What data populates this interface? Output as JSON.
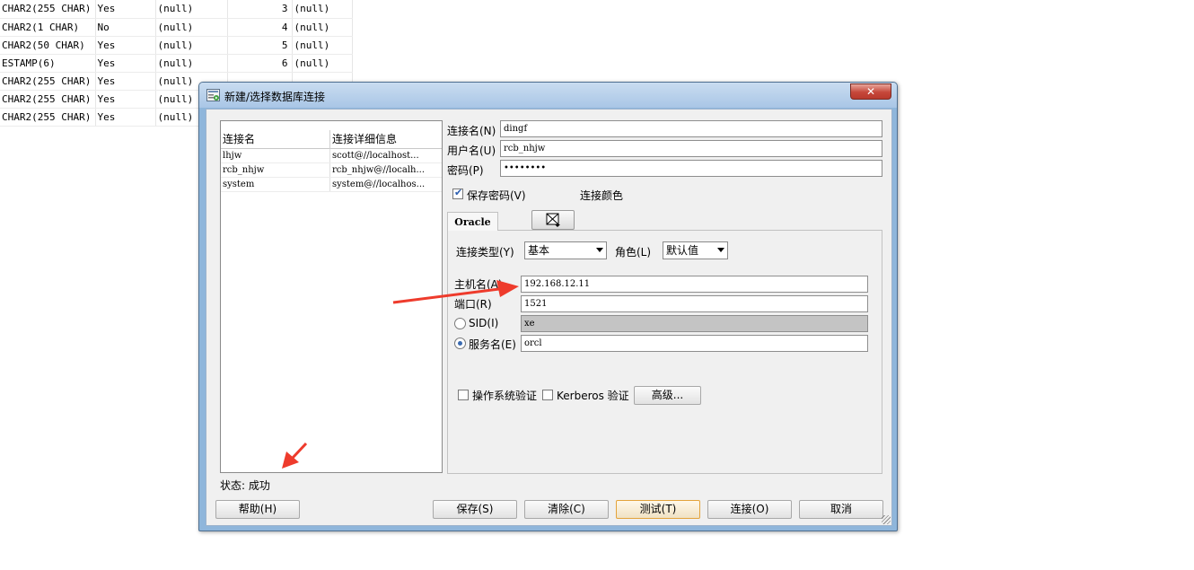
{
  "background_table": [
    [
      "CHAR2(255 CHAR)",
      "Yes",
      "(null)",
      "3",
      "(null)"
    ],
    [
      "CHAR2(1 CHAR)",
      "No",
      "(null)",
      "4",
      "(null)"
    ],
    [
      "CHAR2(50 CHAR)",
      "Yes",
      "(null)",
      "5",
      "(null)"
    ],
    [
      "ESTAMP(6)",
      "Yes",
      "(null)",
      "6",
      "(null)"
    ],
    [
      "CHAR2(255 CHAR)",
      "Yes",
      "(null)",
      "",
      ""
    ],
    [
      "CHAR2(255 CHAR)",
      "Yes",
      "(null)",
      "",
      ""
    ],
    [
      "CHAR2(255 CHAR)",
      "Yes",
      "(null)",
      "",
      ""
    ]
  ],
  "dialog": {
    "title": "新建/选择数据库连接",
    "close_label": "✕",
    "list": {
      "headers": [
        "连接名",
        "连接详细信息"
      ],
      "rows": [
        [
          "lhjw",
          "scott@//localhost..."
        ],
        [
          "rcb_nhjw",
          "rcb_nhjw@//localh..."
        ],
        [
          "system",
          "system@//localhos..."
        ]
      ]
    },
    "status": "状态: 成功",
    "form": {
      "conn_name_label": "连接名(N)",
      "conn_name_value": "dingf",
      "username_label": "用户名(U)",
      "username_value": "rcb_nhjw",
      "password_label": "密码(P)",
      "password_value": "••••••••",
      "save_password_label": "保存密码(V)",
      "save_password_checked": true,
      "conn_color_label": "连接颜色"
    },
    "tab_label": "Oracle",
    "oracle": {
      "conn_type_label": "连接类型(Y)",
      "conn_type_value": "基本",
      "role_label": "角色(L)",
      "role_value": "默认值",
      "host_label": "主机名(A)",
      "host_value": "192.168.12.11",
      "port_label": "端口(R)",
      "port_value": "1521",
      "sid_label": "SID(I)",
      "sid_value": "xe",
      "service_label": "服务名(E)",
      "service_value": "orcl",
      "os_auth_label": "操作系统验证",
      "kerberos_label": "Kerberos 验证",
      "advanced_label": "高级..."
    },
    "buttons": {
      "help": "帮助(H)",
      "save": "保存(S)",
      "clear": "清除(C)",
      "test": "测试(T)",
      "connect": "连接(O)",
      "cancel": "取消"
    }
  },
  "colors": {
    "annotation_arrow": "#ee3b2c",
    "dialog_frame": "#8fb6db",
    "close_button": "#c6473a"
  }
}
